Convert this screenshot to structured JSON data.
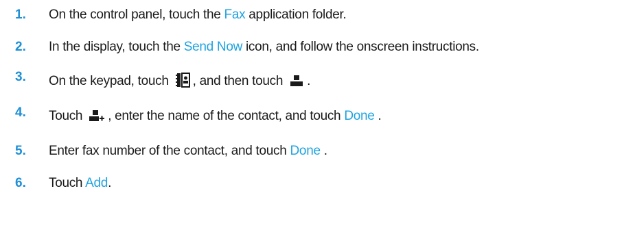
{
  "steps": [
    {
      "number": "1.",
      "before": "On the control panel, touch the ",
      "link": "Fax",
      "after": " application folder."
    },
    {
      "number": "2.",
      "before": "In the display, touch the ",
      "link": "Send Now",
      "after": " icon, and follow the onscreen instructions."
    },
    {
      "number": "3.",
      "before": "On the keypad, touch ",
      "icon1": "contacts-book-icon",
      "middle": ", and then touch ",
      "icon2": "person-icon",
      "after": "."
    },
    {
      "number": "4.",
      "before": "Touch ",
      "icon1": "add-person-icon",
      "middle": ", enter the name of the contact, and touch ",
      "link": "Done",
      "after": " ."
    },
    {
      "number": "5.",
      "before": "Enter fax number of the contact, and touch ",
      "link": "Done",
      "after": " ."
    },
    {
      "number": "6.",
      "before": "Touch ",
      "link": "Add",
      "after": "."
    }
  ],
  "colors": {
    "step_number": "#1f8fd6",
    "link": "#1fa3e0",
    "text": "#1a1a1a"
  }
}
